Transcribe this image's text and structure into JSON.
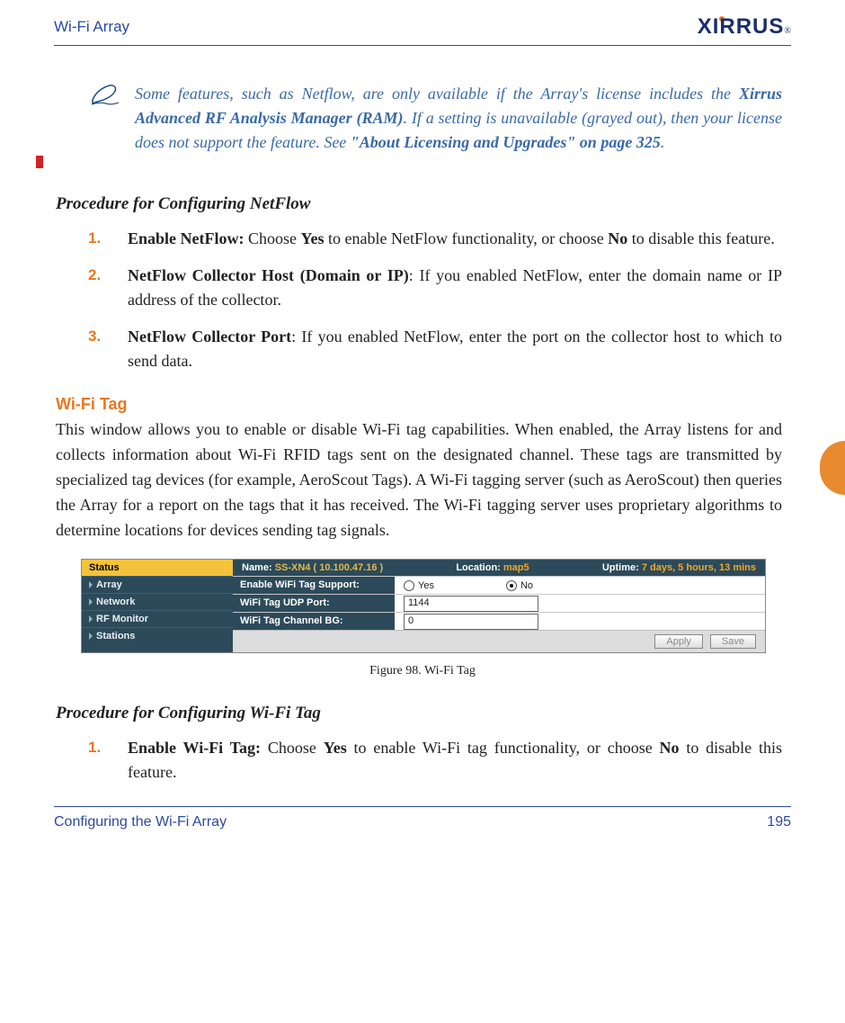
{
  "header": {
    "title": "Wi-Fi Array",
    "logo": "XIRRUS"
  },
  "note": {
    "part1": "Some features, such as Netflow, are only available if the Array's license includes the ",
    "bold1": "Xirrus Advanced RF Analysis Manager (RAM)",
    "part2": ". If a setting is unavailable (grayed out), then your license does not support the feature. See ",
    "bold2": "\"About Licensing and Upgrades\" on page 325",
    "part3": "."
  },
  "procedure_netflow": {
    "heading": "Procedure for Configuring NetFlow",
    "items": [
      {
        "num": "1.",
        "bold": "Enable NetFlow:",
        "mid": " Choose ",
        "b2": "Yes",
        "mid2": " to enable NetFlow functionality, or choose ",
        "b3": "No",
        "tail": " to disable this feature."
      },
      {
        "num": "2.",
        "bold": "NetFlow Collector Host (Domain or IP)",
        "mid": ": If you enabled NetFlow, enter the domain name or IP address of the collector.",
        "b2": "",
        "mid2": "",
        "b3": "",
        "tail": ""
      },
      {
        "num": "3.",
        "bold": "NetFlow Collector Port",
        "mid": ": If you enabled NetFlow, enter the port on the collector host to which to send data.",
        "b2": "",
        "mid2": "",
        "b3": "",
        "tail": ""
      }
    ]
  },
  "wifi_tag": {
    "heading": "Wi-Fi Tag",
    "para": "This window allows you to enable or disable Wi-Fi tag capabilities. When enabled, the Array listens for and collects information about Wi-Fi RFID tags sent on the designated channel. These tags are transmitted by specialized tag devices (for example, AeroScout Tags). A Wi-Fi tagging server (such as AeroScout) then queries the Array for a report on the tags that it has received. The Wi-Fi tagging server uses proprietary algorithms to determine locations for devices sending tag signals."
  },
  "ui": {
    "sidebar": {
      "status": "Status",
      "array": "Array",
      "network": "Network",
      "rf": "RF Monitor",
      "stations": "Stations"
    },
    "info": {
      "name_lbl": "Name:",
      "name_val": "SS-XN4",
      "name_ip": "( 10.100.47.16 )",
      "loc_lbl": "Location:",
      "loc_val": "map5",
      "up_lbl": "Uptime:",
      "up_val": "7 days, 5 hours, 13 mins"
    },
    "rows": {
      "r1": "Enable WiFi Tag Support:",
      "r2": "WiFi Tag UDP Port:",
      "r3": "WiFi Tag Channel BG:"
    },
    "yes": "Yes",
    "no": "No",
    "port_val": "1144",
    "chan_val": "0",
    "apply": "Apply",
    "save": "Save"
  },
  "figure_caption": "Figure 98. Wi-Fi Tag",
  "procedure_wifitag": {
    "heading": "Procedure for Configuring Wi-Fi Tag",
    "items": [
      {
        "num": "1.",
        "bold": "Enable Wi-Fi Tag:",
        "mid": " Choose ",
        "b2": "Yes",
        "mid2": " to enable Wi-Fi tag functionality, or choose ",
        "b3": "No",
        "tail": " to disable this feature."
      }
    ]
  },
  "footer": {
    "left": "Configuring the Wi-Fi Array",
    "right": "195"
  }
}
